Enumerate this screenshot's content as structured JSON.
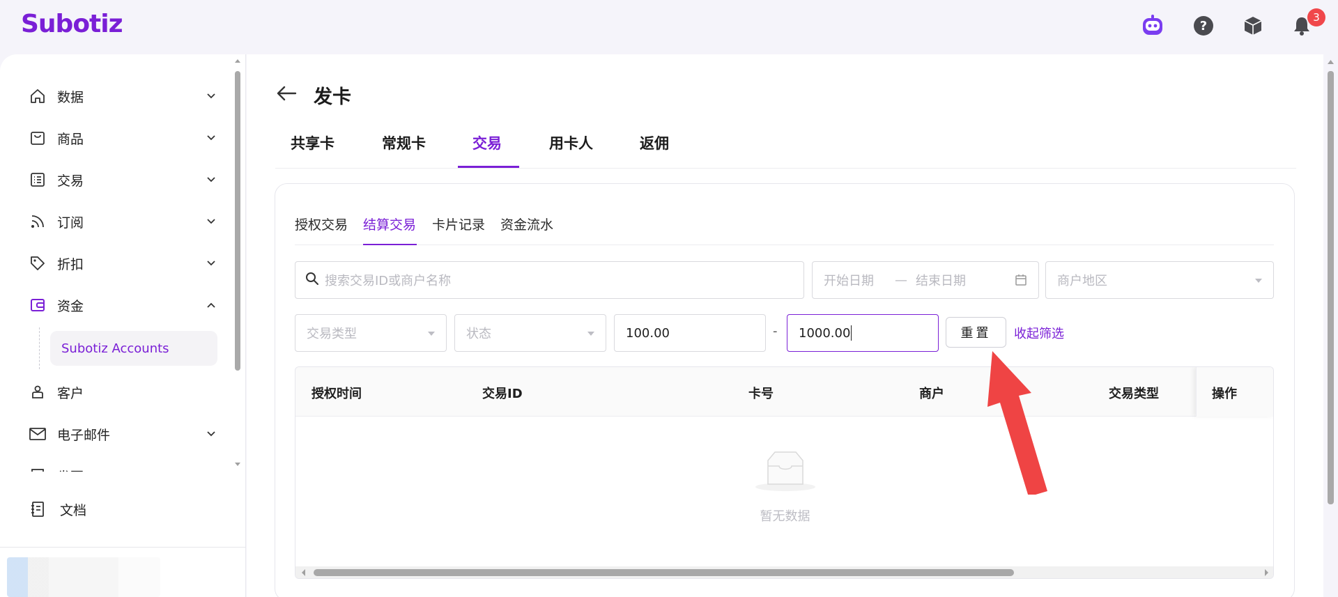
{
  "app": {
    "logo": "Subotiz",
    "notifications_count": "3"
  },
  "header_icons": [
    "bot-icon",
    "help-icon",
    "package-icon",
    "bell-icon"
  ],
  "sidebar": {
    "items": [
      {
        "label": "数据",
        "icon": "home-icon",
        "expandable": true
      },
      {
        "label": "商品",
        "icon": "store-icon",
        "expandable": true
      },
      {
        "label": "交易",
        "icon": "list-icon",
        "expandable": true
      },
      {
        "label": "订阅",
        "icon": "rss-icon",
        "expandable": true
      },
      {
        "label": "折扣",
        "icon": "tag-icon",
        "expandable": true
      },
      {
        "label": "资金",
        "icon": "wallet-icon",
        "expandable": true,
        "expanded": true
      },
      {
        "label": "客户",
        "icon": "user-icon",
        "expandable": false
      },
      {
        "label": "电子邮件",
        "icon": "mail-icon",
        "expandable": true
      },
      {
        "label": "发票",
        "icon": "invoice-icon",
        "expandable": true
      }
    ],
    "sub_item": "Subotiz Accounts",
    "docs": "文档"
  },
  "page": {
    "title": "发卡",
    "tabs": [
      "共享卡",
      "常规卡",
      "交易",
      "用卡人",
      "返佣"
    ],
    "active_tab": "交易",
    "subtabs": [
      "授权交易",
      "结算交易",
      "卡片记录",
      "资金流水"
    ],
    "active_subtab": "结算交易"
  },
  "filters": {
    "search_placeholder": "搜索交易ID或商户名称",
    "start_date": "开始日期",
    "date_sep": "—",
    "end_date": "结束日期",
    "region": "商户地区",
    "type": "交易类型",
    "status": "状态",
    "min_amount": "100.00",
    "range_sep": "-",
    "max_amount": "1000.00",
    "reset": "重置",
    "collapse": "收起筛选"
  },
  "table": {
    "columns": [
      "授权时间",
      "交易ID",
      "卡号",
      "商户",
      "交易类型",
      "操作"
    ],
    "empty_text": "暂无数据"
  },
  "colors": {
    "accent": "#7a1fd6",
    "badge": "#f0474b",
    "annotation_arrow": "#ef4444"
  }
}
